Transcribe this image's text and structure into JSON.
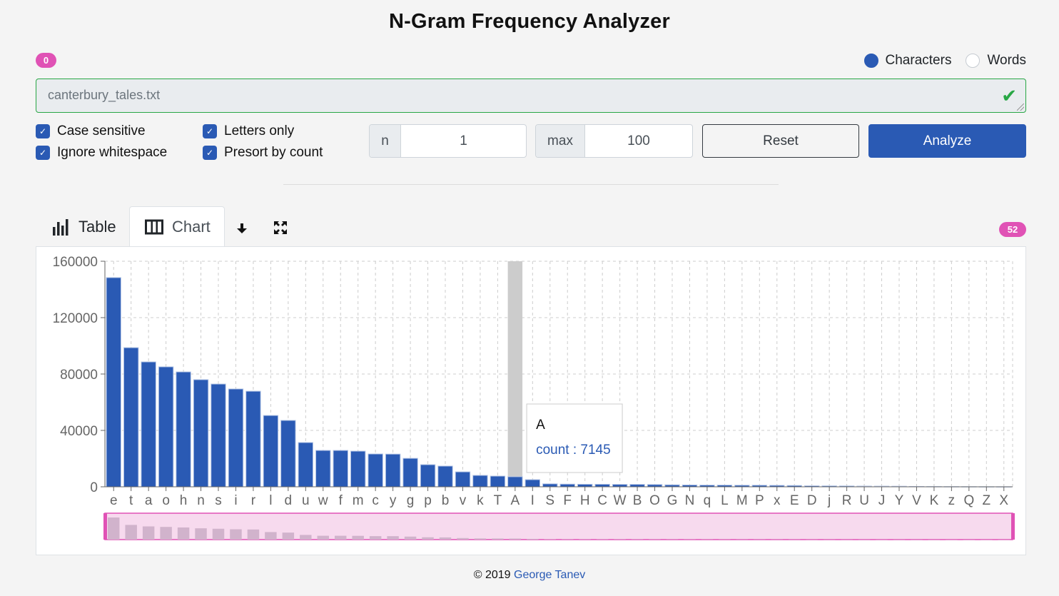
{
  "app": {
    "title": "N-Gram Frequency Analyzer"
  },
  "status_badge": "0",
  "mode": {
    "options": [
      {
        "label": "Characters",
        "selected": true
      },
      {
        "label": "Words",
        "selected": false
      }
    ]
  },
  "file": {
    "value": "canterbury_tales.txt",
    "valid": true
  },
  "options": {
    "case_sensitive": {
      "label": "Case sensitive",
      "checked": true
    },
    "ignore_whitespace": {
      "label": "Ignore whitespace",
      "checked": true
    },
    "letters_only": {
      "label": "Letters only",
      "checked": true
    },
    "presort_by_count": {
      "label": "Presort by count",
      "checked": true
    }
  },
  "params": {
    "n": {
      "label": "n",
      "value": "1"
    },
    "max": {
      "label": "max",
      "value": "100"
    }
  },
  "buttons": {
    "reset": "Reset",
    "analyze": "Analyze"
  },
  "tabs": [
    {
      "label": "Table",
      "icon": "bar-chart-icon",
      "active": false
    },
    {
      "label": "Chart",
      "icon": "columns-icon",
      "active": true
    }
  ],
  "toolbar": {
    "download_icon": "download-icon",
    "fullscreen_icon": "fullscreen-icon"
  },
  "result_count_badge": "52",
  "tooltip": {
    "label": "A",
    "series": "count",
    "value": "7145",
    "text": "count : 7145"
  },
  "colors": {
    "accent": "#2a5ab4",
    "badge": "#e052b5",
    "valid": "#28a745",
    "brush_fill": "#f7daee",
    "brush_bars": "#d1b3cc",
    "highlight": "#cccccc"
  },
  "footer": {
    "copyright": "© 2019",
    "author": "George Tanev"
  },
  "chart_data": {
    "type": "bar",
    "title": "",
    "xlabel": "",
    "ylabel": "",
    "ylim": [
      0,
      160000
    ],
    "yticks": [
      0,
      40000,
      80000,
      120000,
      160000
    ],
    "grid": true,
    "highlighted_category": "A",
    "brush": true,
    "categories": [
      "e",
      "t",
      "a",
      "o",
      "h",
      "n",
      "s",
      "i",
      "r",
      "l",
      "d",
      "u",
      "w",
      "f",
      "m",
      "c",
      "y",
      "g",
      "p",
      "b",
      "v",
      "k",
      "T",
      "A",
      "I",
      "S",
      "F",
      "H",
      "C",
      "W",
      "B",
      "O",
      "G",
      "N",
      "q",
      "L",
      "M",
      "P",
      "x",
      "E",
      "D",
      "j",
      "R",
      "U",
      "J",
      "Y",
      "V",
      "K",
      "z",
      "Q",
      "Z",
      "X"
    ],
    "series": [
      {
        "name": "count",
        "values": [
          148400,
          98700,
          88600,
          85100,
          81500,
          76000,
          72900,
          69400,
          67800,
          50600,
          47100,
          31400,
          25800,
          25800,
          25300,
          23300,
          23200,
          20200,
          15700,
          14700,
          10600,
          8100,
          7600,
          7145,
          5060,
          2100,
          1900,
          1800,
          1800,
          1700,
          1700,
          1600,
          1400,
          1300,
          1200,
          1200,
          1100,
          1100,
          1000,
          900,
          700,
          650,
          600,
          500,
          450,
          400,
          250,
          200,
          150,
          120,
          80,
          60
        ]
      }
    ]
  }
}
